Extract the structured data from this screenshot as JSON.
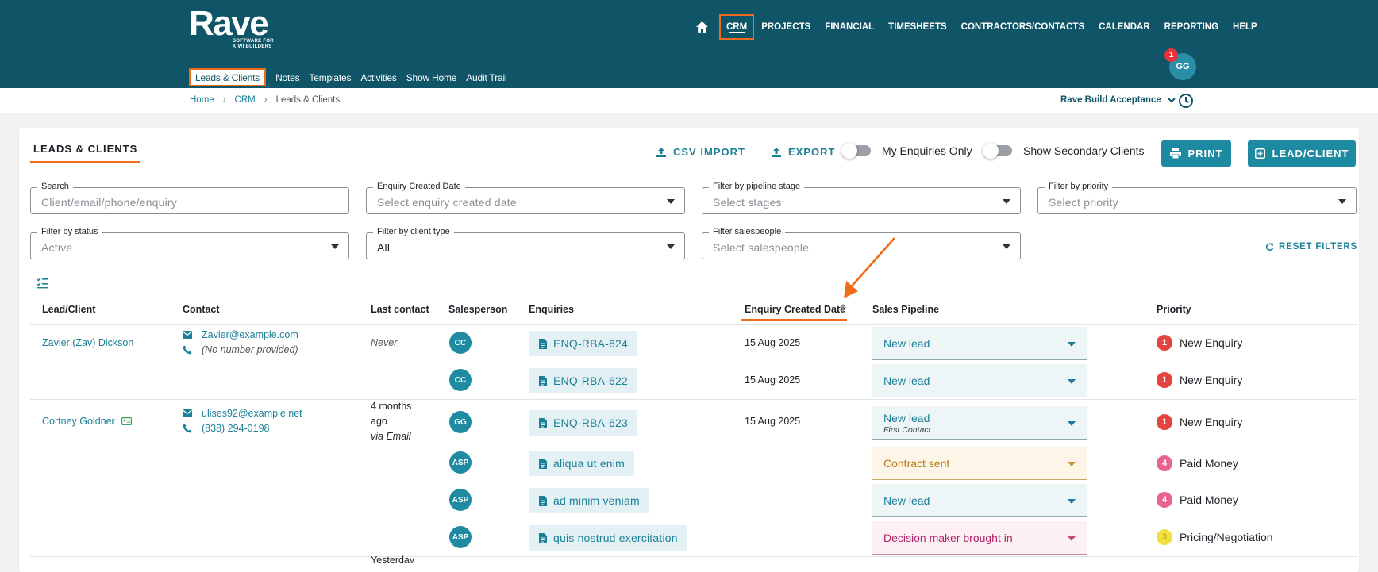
{
  "brand": {
    "name": "Rave",
    "tagline_line1": "SOFTWARE FOR",
    "tagline_line2": "KIWI BUILDERS"
  },
  "main_nav": [
    "CRM",
    "PROJECTS",
    "FINANCIAL",
    "TIMESHEETS",
    "CONTRACTORS/CONTACTS",
    "CALENDAR",
    "REPORTING",
    "HELP"
  ],
  "sub_nav": [
    "Leads & Clients",
    "Notes",
    "Templates",
    "Activities",
    "Show Home",
    "Audit Trail"
  ],
  "user": {
    "initials": "GG",
    "notifications": "1"
  },
  "breadcrumb": [
    "Home",
    "CRM",
    "Leads & Clients"
  ],
  "breadcrumb_sep": "›",
  "project": "Rave Build Acceptance",
  "card": {
    "title": "LEADS & CLIENTS",
    "csv_import": "CSV IMPORT",
    "export": "EXPORT",
    "my_enquiries": "My Enquiries Only",
    "secondary_clients": "Show Secondary Clients",
    "print": "PRINT",
    "lead_client": "LEAD/CLIENT",
    "reset": "RESET FILTERS"
  },
  "filters": {
    "search": {
      "label": "Search",
      "placeholder": "Client/email/phone/enquiry"
    },
    "created": {
      "label": "Enquiry Created Date",
      "placeholder": "Select enquiry created date"
    },
    "stage": {
      "label": "Filter by pipeline stage",
      "placeholder": "Select stages"
    },
    "priority": {
      "label": "Filter by priority",
      "placeholder": "Select priority"
    },
    "status": {
      "label": "Filter by status",
      "value": "Active"
    },
    "client_type": {
      "label": "Filter by client type",
      "value": "All"
    },
    "salespeople": {
      "label": "Filter salespeople",
      "placeholder": "Select salespeople"
    }
  },
  "columns": [
    "Lead/Client",
    "Contact",
    "Last contact",
    "Salesperson",
    "Enquiries",
    "Enquiry Created Date",
    "Sales Pipeline",
    "Priority"
  ],
  "colors": {
    "header": "#0f5467",
    "accent": "#ef6c1a",
    "teal": "#1d8aa1"
  },
  "leads": [
    {
      "name": "Zavier (Zav) Dickson",
      "email": "Zavier@example.com",
      "phone": "(No number provided)",
      "last_contact": "Never",
      "enquiries": [
        {
          "sp": "CC",
          "id": "ENQ-RBA-624",
          "date": "15 Aug 2025",
          "pipeline": "New lead",
          "priority_num": "1",
          "priority": "New Enquiry"
        },
        {
          "sp": "CC",
          "id": "ENQ-RBA-622",
          "date": "15 Aug 2025",
          "pipeline": "New lead",
          "priority_num": "1",
          "priority": "New Enquiry"
        }
      ]
    },
    {
      "name": "Cortney Goldner",
      "email": "ulises92@example.net",
      "phone": "(838) 294-0198",
      "last_contact_1": "4 months",
      "last_contact_2": "ago",
      "last_contact_3": "via Email",
      "enquiries": [
        {
          "sp": "GG",
          "id": "ENQ-RBA-623",
          "date": "15 Aug 2025",
          "pipeline": "New lead",
          "pipeline_sub": "First Contact",
          "priority_num": "1",
          "priority": "New Enquiry"
        },
        {
          "sp": "ASP",
          "id": "aliqua ut enim",
          "pipeline": "Contract sent",
          "priority_num": "4",
          "priority": "Paid Money"
        },
        {
          "sp": "ASP",
          "id": "ad minim veniam",
          "pipeline": "New lead",
          "priority_num": "4",
          "priority": "Paid Money"
        },
        {
          "sp": "ASP",
          "id": "quis nostrud exercitation",
          "pipeline": "Decision maker brought in",
          "priority_num": "3",
          "priority": "Pricing/Negotiation"
        }
      ]
    }
  ],
  "next_row_last_contact": "Yesterday"
}
